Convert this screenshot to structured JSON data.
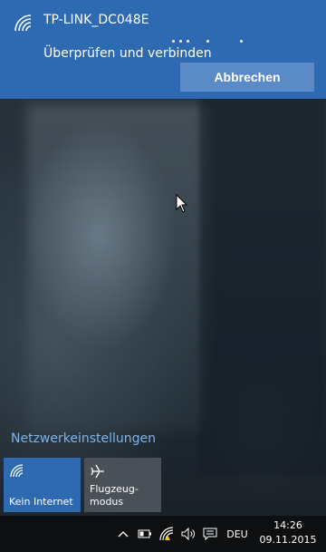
{
  "network": {
    "ssid": "TP-LINK_DC048E",
    "status": "Überprüfen und verbinden",
    "cancel_label": "Abbrechen",
    "icon": "wifi-icon"
  },
  "settings_link": "Netzwerkeinstellungen",
  "tiles": [
    {
      "label": "Kein Internet",
      "icon": "wifi-icon",
      "active": true
    },
    {
      "label": "Flugzeug-\nmodus",
      "icon": "airplane-icon",
      "active": false
    }
  ],
  "taskbar": {
    "language": "DEU",
    "time": "14:26",
    "date": "09.11.2015",
    "tray_icons": [
      "chevron-up-icon",
      "battery-icon",
      "wifi-warning-icon",
      "speaker-icon",
      "action-center-icon"
    ]
  },
  "colors": {
    "accent": "#2d6ab1",
    "button": "#5b8bc7",
    "link": "#7fb4ea",
    "taskbar": "#0d0f11"
  }
}
